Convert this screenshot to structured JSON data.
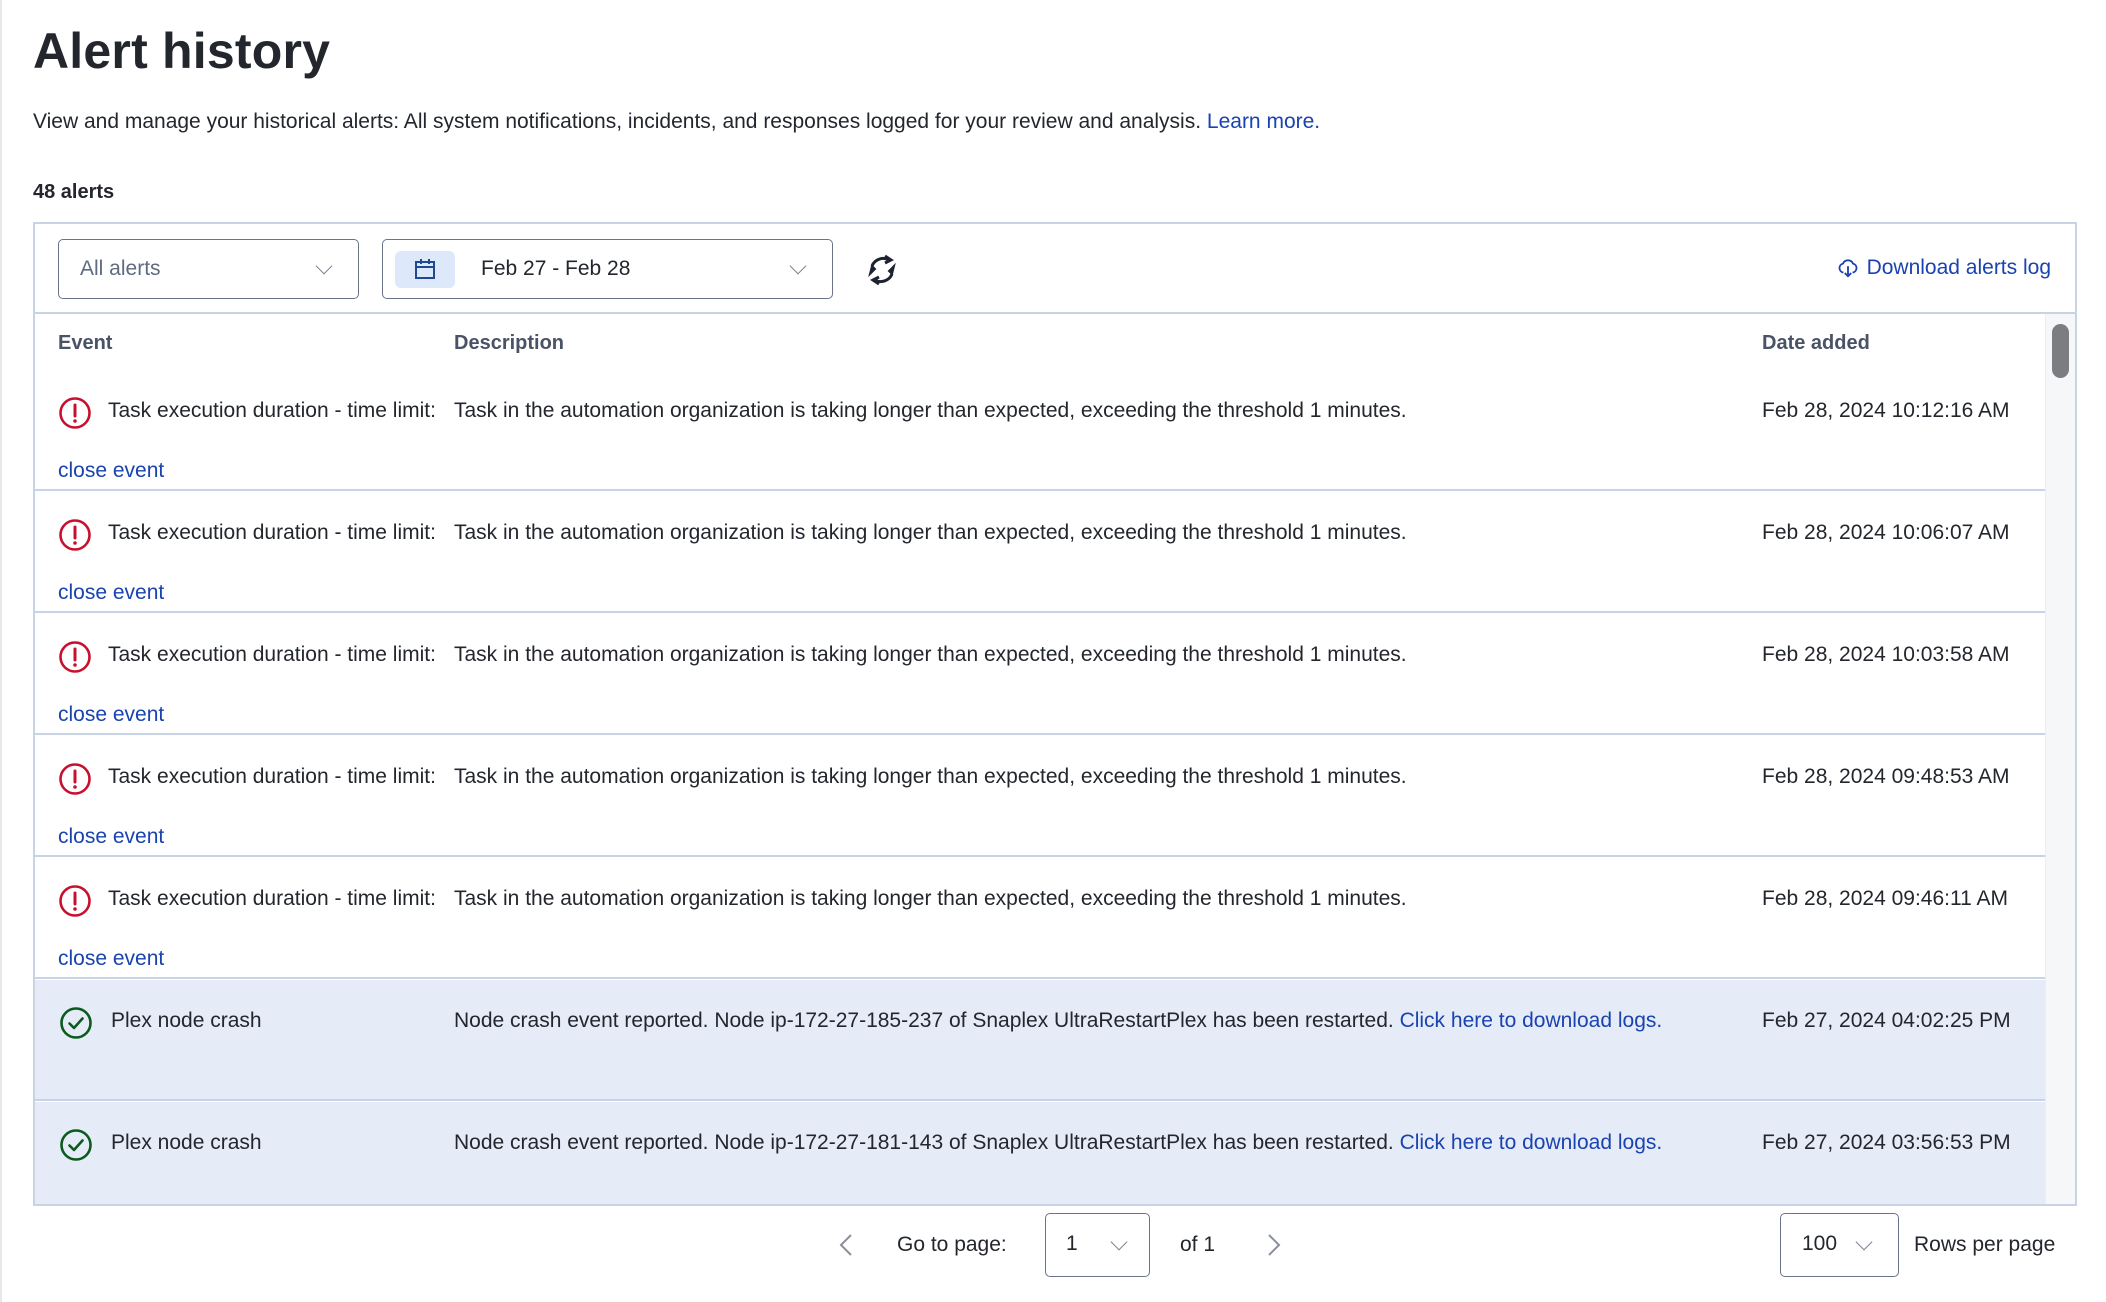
{
  "page": {
    "title": "Alert history",
    "description": "View and manage your historical alerts: All system notifications, incidents, and responses logged for your review and analysis.",
    "learn_more": "Learn more.",
    "count_label": "48 alerts"
  },
  "toolbar": {
    "alert_filter": {
      "value": "All alerts",
      "icon": "chevron-down-icon"
    },
    "date_range": {
      "value": "Feb 27 - Feb 28",
      "icon": "calendar-icon"
    },
    "refresh_icon": "refresh-icon",
    "download_label": "Download alerts log",
    "download_icon": "cloud-download-icon"
  },
  "table": {
    "columns": [
      "Event",
      "Description",
      "Date added"
    ],
    "rows": [
      {
        "status": "error",
        "event": "Task execution duration - time limit:",
        "event_link": "close event",
        "description": "Task in the automation organization is taking longer than expected, exceeding the threshold 1 minutes.",
        "description_link": "",
        "date": "Feb 28, 2024 10:12:16 AM",
        "highlighted": false
      },
      {
        "status": "error",
        "event": "Task execution duration - time limit:",
        "event_link": "close event",
        "description": "Task in the automation organization is taking longer than expected, exceeding the threshold 1 minutes.",
        "description_link": "",
        "date": "Feb 28, 2024 10:06:07 AM",
        "highlighted": false
      },
      {
        "status": "error",
        "event": "Task execution duration - time limit:",
        "event_link": "close event",
        "description": "Task in the automation organization is taking longer than expected, exceeding the threshold 1 minutes.",
        "description_link": "",
        "date": "Feb 28, 2024 10:03:58 AM",
        "highlighted": false
      },
      {
        "status": "error",
        "event": "Task execution duration - time limit:",
        "event_link": "close event",
        "description": "Task in the automation organization is taking longer than expected, exceeding the threshold 1 minutes.",
        "description_link": "",
        "date": "Feb 28, 2024 09:48:53 AM",
        "highlighted": false
      },
      {
        "status": "error",
        "event": "Task execution duration - time limit:",
        "event_link": "close event",
        "description": "Task in the automation organization is taking longer than expected, exceeding the threshold 1 minutes.",
        "description_link": "",
        "date": "Feb 28, 2024 09:46:11 AM",
        "highlighted": false
      },
      {
        "status": "success",
        "event": "Plex node crash",
        "event_link": "",
        "description": "Node crash event reported. Node ip-172-27-185-237 of Snaplex UltraRestartPlex has been restarted.",
        "description_link": "Click here to download logs.",
        "date": "Feb 27, 2024 04:02:25 PM",
        "highlighted": true
      },
      {
        "status": "success",
        "event": "Plex node crash",
        "event_link": "",
        "description": "Node crash event reported. Node ip-172-27-181-143 of Snaplex UltraRestartPlex has been restarted.",
        "description_link": "Click here to download logs.",
        "date": "Feb 27, 2024 03:56:53 PM",
        "highlighted": true
      }
    ]
  },
  "pagination": {
    "go_to_label": "Go to page:",
    "current_page": "1",
    "of_label": "of 1",
    "rows_per_page": "100",
    "rows_per_page_label": "Rows per page"
  },
  "colors": {
    "link": "#1a43b0",
    "error": "#c8102e",
    "success": "#0b5a1e",
    "highlight_row": "#e5ebf7",
    "border": "#c8d3e6"
  }
}
